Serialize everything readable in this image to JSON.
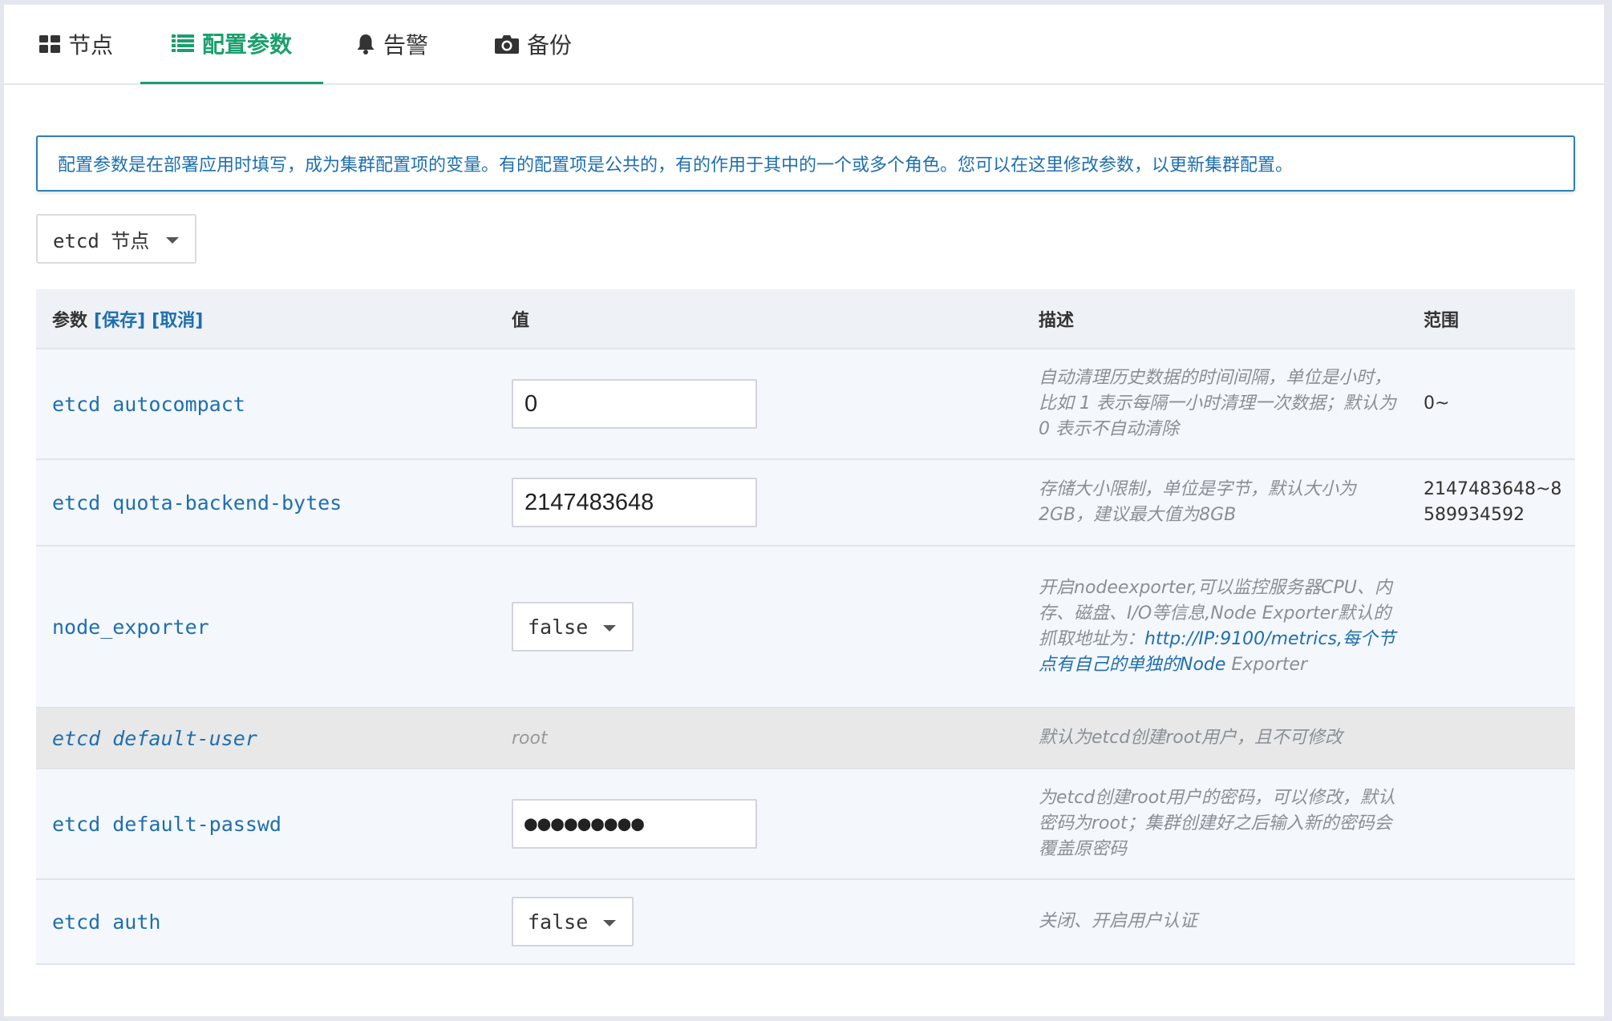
{
  "tabs": [
    {
      "label": "节点",
      "icon": "grid-icon"
    },
    {
      "label": "配置参数",
      "icon": "list-icon",
      "active": true
    },
    {
      "label": "告警",
      "icon": "bell-icon"
    },
    {
      "label": "备份",
      "icon": "camera-icon"
    }
  ],
  "info": "配置参数是在部署应用时填写，成为集群配置项的变量。有的配置项是公共的，有的作用于其中的一个或多个角色。您可以在这里修改参数，以更新集群配置。",
  "role_select": {
    "value": "etcd 节点"
  },
  "table": {
    "headers": {
      "param": "参数",
      "save": "[保存]",
      "cancel": "[取消]",
      "value": "值",
      "desc": "描述",
      "range": "范围"
    },
    "rows": [
      {
        "name": "etcd autocompact",
        "value": "0",
        "desc": "自动清理历史数据的时间间隔，单位是小时，比如 1 表示每隔一小时清理一次数据；默认为 0 表示不自动清除",
        "range": "0~"
      },
      {
        "name": "etcd quota-backend-bytes",
        "value": "2147483648",
        "desc": "存储大小限制，单位是字节，默认大小为2GB，建议最大值为8GB",
        "range": "2147483648~8589934592"
      },
      {
        "name": "node_exporter",
        "value": "false",
        "desc_pre": "开启nodeexporter,可以监控服务器CPU、内存、磁盘、I/O等信息,Node Exporter默认的抓取地址为：",
        "desc_link": "http://IP:9100/metrics,每个节点有自己的单独的Node",
        "desc_post": " Exporter"
      },
      {
        "name": "etcd default-user",
        "value": "root",
        "desc": "默认为etcd创建root用户，且不可修改"
      },
      {
        "name": "etcd default-passwd",
        "value": "●●●●●●●●●",
        "desc": "为etcd创建root用户的密码，可以修改，默认密码为root；集群创建好之后输入新的密码会覆盖原密码"
      },
      {
        "name": "etcd auth",
        "value": "false",
        "desc": "关闭、开启用户认证"
      }
    ]
  },
  "colors": {
    "accent": "#1aa06d",
    "link": "#1f6fae"
  }
}
